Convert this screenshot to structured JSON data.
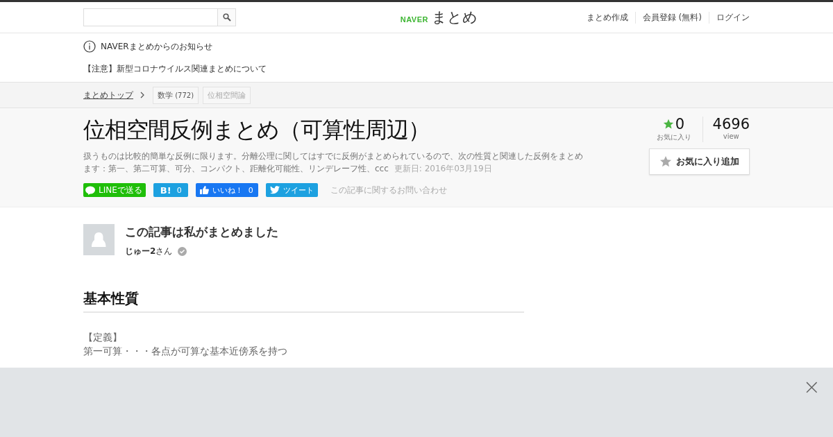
{
  "header": {
    "logo": {
      "brand": "NAVER",
      "title": "まとめ"
    },
    "nav": [
      "まとめ作成",
      "会員登録 (無料)",
      "ログイン"
    ]
  },
  "notice": {
    "title": "NAVERまとめからのお知らせ",
    "items": [
      "【注意】新型コロナウイルス関連まとめについて"
    ]
  },
  "breadcrumb": {
    "home": "まとめトップ",
    "tags": [
      {
        "label": "数学",
        "count": "(772)",
        "kind": "category"
      },
      {
        "label": "位相空間論",
        "kind": "tag"
      }
    ]
  },
  "article": {
    "title": "位相空間反例まとめ（可算性周辺）",
    "description": "扱うものは比較的簡単な反例に限ります。分離公理に関してはすでに反例がまとめられているので、次の性質と関連した反例をまとめます：第一、第二可算、可分、コンパクト、距離化可能性、リンデレーフ性、ccc",
    "updated": "更新日: 2016年03月19日",
    "share": [
      {
        "kind": "line",
        "label": "LINEで送る"
      },
      {
        "kind": "hatena",
        "label": "B!",
        "count": "0"
      },
      {
        "kind": "facebook",
        "label": "いいね！",
        "count": "0"
      },
      {
        "kind": "twitter",
        "label": "ツイート"
      }
    ],
    "contact": "この記事に関するお問い合わせ",
    "stats": {
      "favorites": "0",
      "favorites_label": "お気に入り",
      "views": "4696",
      "views_label": "view"
    },
    "favorite_button": "お気に入り追加"
  },
  "author": {
    "heading": "この記事は私がまとめました",
    "name": "**じゅー2**さん",
    "verified": true
  },
  "section": {
    "heading": "基本性質",
    "lines": [
      "【定義】",
      "第一可算・・・各点が可算な基本近傍系を持つ"
    ]
  },
  "ad_overlay": {
    "close": "×"
  }
}
